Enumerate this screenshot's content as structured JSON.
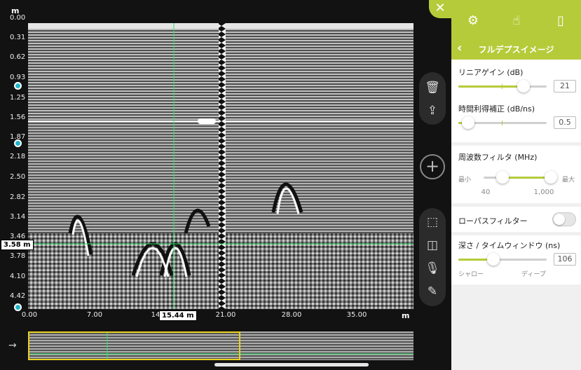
{
  "radargram": {
    "depth_unit": "m",
    "distance_unit": "m",
    "depth_ticks": [
      "0.00",
      "0.31",
      "0.62",
      "0.93",
      "1.25",
      "1.56",
      "1.87",
      "2.18",
      "2.50",
      "2.82",
      "3.14",
      "3.46",
      "3.78",
      "4.10",
      "4.42"
    ],
    "distance_ticks": [
      "0.00",
      "7.00",
      "14",
      "21.00",
      "28.00",
      "35.00"
    ],
    "cursor_depth": "3.58 m",
    "cursor_distance": "15.44 m",
    "colors": {
      "cursor": "#2ee36a",
      "handle": "#1fb7c8"
    }
  },
  "tools": {
    "delete_icon": "trash-icon",
    "share_icon": "share-icon",
    "add_icon": "plus-icon",
    "select_icon": "selection-icon",
    "compare_icon": "split-view-icon",
    "mic_icon": "microphone-icon",
    "pen_icon": "pen-icon"
  },
  "panel": {
    "title": "フルデプスイメージ",
    "accent_color": "#b6cb3a",
    "linear_gain": {
      "label": "リニアゲイン (dB)",
      "value": "21",
      "level": 0.74
    },
    "time_gain": {
      "label": "時間利得補正 (dB/ns)",
      "value": "0.5",
      "level": 0.11
    },
    "frequency_filter": {
      "label": "周波数フィルタ (MHz)",
      "min_label": "最小",
      "max_label": "最大",
      "low_value": "40",
      "high_value": "1,000",
      "low_level": 0.28,
      "high_level": 1.0
    },
    "lowpass": {
      "label": "ローパスフィルター",
      "enabled": false
    },
    "depth_window": {
      "label": "深さ / タイムウィンドウ (ns)",
      "value": "106",
      "shallow_label": "シャロー",
      "deep_label": "ディープ",
      "level": 0.4
    }
  }
}
